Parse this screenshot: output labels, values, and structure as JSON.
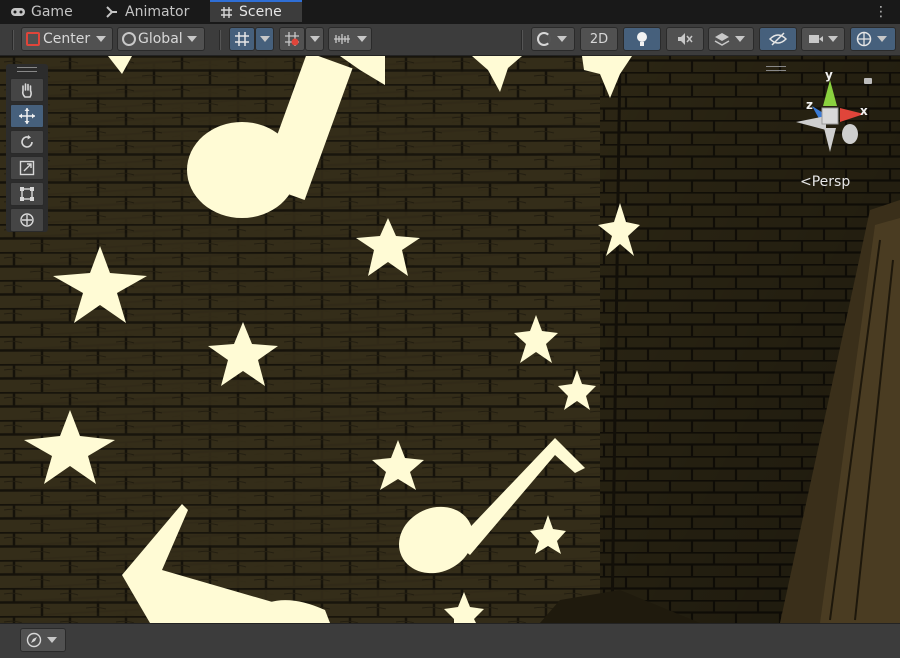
{
  "tabs": [
    {
      "label": "Game",
      "icon": "gamepad-icon"
    },
    {
      "label": "Animator",
      "icon": "animator-icon"
    },
    {
      "label": "Scene",
      "icon": "hash-icon",
      "active": true
    }
  ],
  "toolbar": {
    "pivot_label": "Center",
    "space_label": "Global",
    "mode_2d_label": "2D"
  },
  "gizmo": {
    "axis_y": "y",
    "axis_x": "x",
    "axis_z": "z",
    "projection_label": "Persp"
  },
  "colors": {
    "accent": "#2f6fd6",
    "active_button": "#46607c",
    "toolbar_bg": "#3c3c3c",
    "scene_wall": "#2e2816",
    "shape_fill": "#fffbd5",
    "axis_x": "#e0453a",
    "axis_y": "#8ad13f",
    "axis_z": "#3b7bd6"
  },
  "tools": [
    "hand-tool",
    "move-tool",
    "rotate-tool",
    "scale-tool",
    "rect-tool",
    "transform-tool"
  ]
}
